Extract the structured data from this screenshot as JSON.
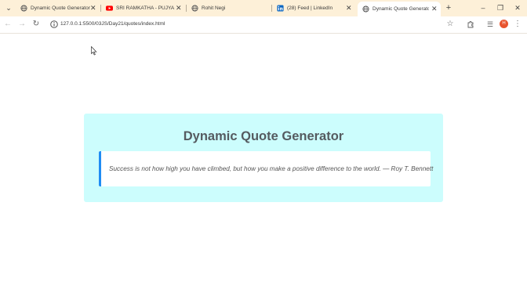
{
  "browser": {
    "tabs": [
      {
        "title": "Dynamic Quote Generator",
        "icon": "globe-icon",
        "active": false
      },
      {
        "title": "SRI RAMKATHA - PUJYA RA",
        "icon": "youtube-icon",
        "active": false
      },
      {
        "title": "Rohit Negi",
        "icon": "globe-icon",
        "active": false
      },
      {
        "title": "(28) Feed | LinkedIn",
        "icon": "linkedin-icon",
        "active": false
      },
      {
        "title": "Dynamic Quote Generator",
        "icon": "globe-icon",
        "active": true
      }
    ],
    "url": "127.0.0.1:5500/03JS/Day21/quotes/index.html",
    "profile_initial": "H"
  },
  "page": {
    "title": "Dynamic Quote Generator",
    "quote": "Success is not how high you have climbed, but how you make a positive difference to the world. — Roy T. Bennett"
  },
  "colors": {
    "card_background": "#ccfdfd",
    "quote_accent": "#1f8cf3",
    "title_text": "#555b60",
    "tabbar_background": "#fdf0d8"
  }
}
